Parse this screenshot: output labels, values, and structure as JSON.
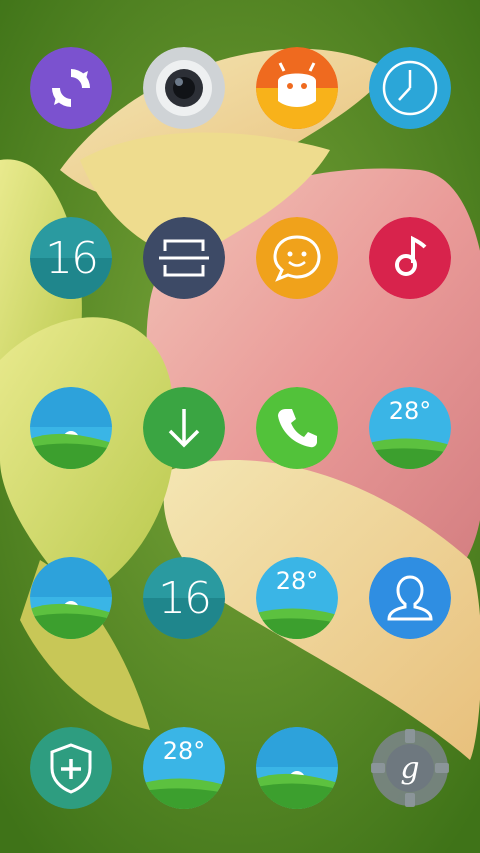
{
  "screen": {
    "type": "home-screen",
    "wallpaper": "pink-lotus-bud-on-green"
  },
  "colors": {
    "purple": "#7b52cf",
    "camera_gray": "#cfd3d6",
    "mi_orange": "#ef6a1f",
    "clock_blue": "#2ba6d8",
    "teal": "#2a9aa0",
    "slate": "#3d4a66",
    "smile_yellow": "#f0a21b",
    "music_red": "#d8234c",
    "green": "#3aa542",
    "phone_green": "#52c23a",
    "contacts_blue": "#2f8ee2",
    "shield_teal": "#2e9d80",
    "gear_gray": "#7c858c"
  },
  "rows": [
    [
      {
        "icon": "swirl-icon"
      },
      {
        "icon": "camera-icon"
      },
      {
        "icon": "mi-icon"
      },
      {
        "icon": "clock-icon"
      }
    ],
    [
      {
        "icon": "calendar-icon",
        "text": "16"
      },
      {
        "icon": "scanner-icon"
      },
      {
        "icon": "message-icon"
      },
      {
        "icon": "music-icon"
      }
    ],
    [
      {
        "icon": "gallery-icon"
      },
      {
        "icon": "download-icon"
      },
      {
        "icon": "phone-icon"
      },
      {
        "icon": "weather-icon",
        "text": "28°"
      }
    ],
    [
      {
        "icon": "gallery-icon"
      },
      {
        "icon": "calendar-icon",
        "text": "16"
      },
      {
        "icon": "weather-icon",
        "text": "28°"
      },
      {
        "icon": "contacts-icon"
      }
    ],
    [
      {
        "icon": "security-icon"
      },
      {
        "icon": "weather-icon",
        "text": "28°"
      },
      {
        "icon": "gallery-icon"
      },
      {
        "icon": "google-settings-icon",
        "text": "g"
      }
    ]
  ]
}
